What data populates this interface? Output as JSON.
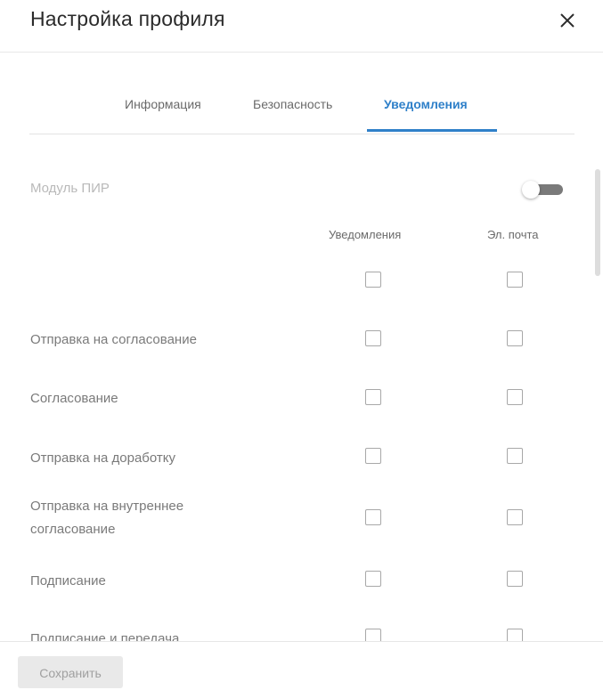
{
  "dialog": {
    "title": "Настройка профиля"
  },
  "tabs": [
    {
      "label": "Информация",
      "active": false
    },
    {
      "label": "Безопасность",
      "active": false
    },
    {
      "label": "Уведомления",
      "active": true
    }
  ],
  "module": {
    "label": "Модуль ПИР",
    "enabled": false
  },
  "columns": {
    "notifications": "Уведомления",
    "email": "Эл. почта"
  },
  "rows": [
    {
      "label": "",
      "notifications": false,
      "email": false
    },
    {
      "label": "Отправка на согласование",
      "notifications": false,
      "email": false
    },
    {
      "label": "Согласование",
      "notifications": false,
      "email": false
    },
    {
      "label": "Отправка на доработку",
      "notifications": false,
      "email": false
    },
    {
      "label": "Отправка на внутреннее согласование",
      "notifications": false,
      "email": false
    },
    {
      "label": "Подписание",
      "notifications": false,
      "email": false
    },
    {
      "label": "Подписание и передача",
      "notifications": false,
      "email": false
    }
  ],
  "footer": {
    "save_label": "Сохранить"
  },
  "colors": {
    "accent": "#2f80c9",
    "toggle_track": "#7a7a7a"
  }
}
